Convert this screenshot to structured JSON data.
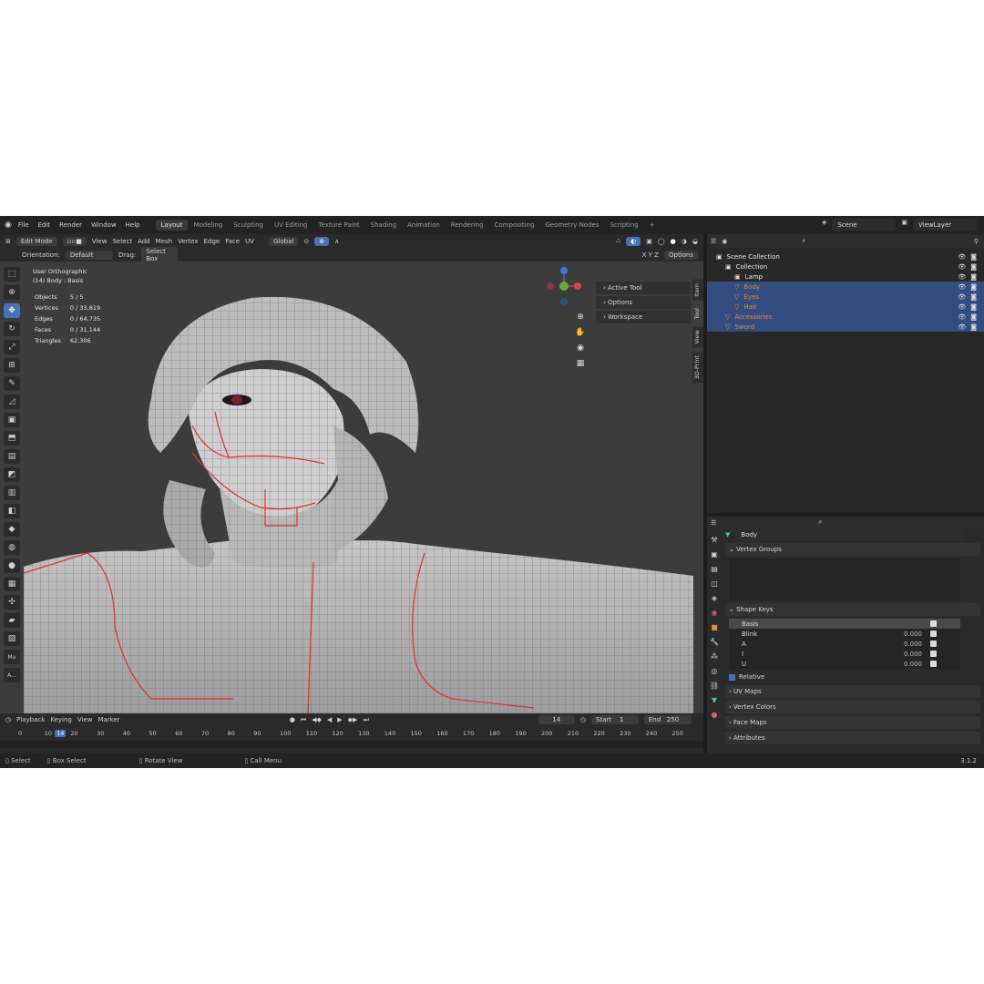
{
  "menu": [
    "File",
    "Edit",
    "Render",
    "Window",
    "Help"
  ],
  "workspaces": [
    "Layout",
    "Modeling",
    "Sculpting",
    "UV Editing",
    "Texture Paint",
    "Shading",
    "Animation",
    "Rendering",
    "Compositing",
    "Geometry Nodes",
    "Scripting",
    "+"
  ],
  "scene": "Scene",
  "view_layer": "ViewLayer",
  "viewport": {
    "mode": "Edit Mode",
    "header_menu": [
      "View",
      "Select",
      "Add",
      "Mesh",
      "Vertex",
      "Edge",
      "Face",
      "UV"
    ],
    "transform": "Global",
    "orientation_label": "Orientation:",
    "orientation_value": "Default",
    "drag_label": "Drag:",
    "drag_value": "Select Box",
    "options": "Options",
    "xyz": "X Y Z",
    "view_name": "User Orthographic",
    "object_name": "(14) Body : Basis",
    "stats": [
      {
        "label": "Objects",
        "value": "5 / 5"
      },
      {
        "label": "Vertices",
        "value": "0 / 33,819"
      },
      {
        "label": "Edges",
        "value": "0 / 64,735"
      },
      {
        "label": "Faces",
        "value": "0 / 31,144"
      },
      {
        "label": "Triangles",
        "value": "62,306"
      }
    ],
    "npanel_items": [
      "Active Tool",
      "Options",
      "Workspace"
    ],
    "side_tabs": [
      "Item",
      "Tool",
      "View",
      "3D-Print"
    ],
    "mini_labels": [
      "Mu",
      "A..."
    ]
  },
  "timeline": {
    "menu": [
      "Playback",
      "Keying",
      "View",
      "Marker"
    ],
    "current_frame": "14",
    "start_label": "Start",
    "start": "1",
    "end_label": "End",
    "end": "250",
    "ticks": [
      "0",
      "10",
      "14",
      "20",
      "30",
      "40",
      "50",
      "60",
      "70",
      "80",
      "90",
      "100",
      "110",
      "120",
      "130",
      "140",
      "150",
      "160",
      "170",
      "180",
      "190",
      "200",
      "210",
      "220",
      "230",
      "240",
      "250"
    ]
  },
  "statusbar": {
    "select": "Select",
    "box_select": "Box Select",
    "rotate": "Rotate View",
    "call_menu": "Call Menu",
    "version": "3.1.2"
  },
  "outliner": {
    "items": [
      {
        "name": "Scene Collection",
        "indent": 0,
        "sel": false,
        "white": true
      },
      {
        "name": "Collection",
        "indent": 1,
        "sel": false,
        "white": true
      },
      {
        "name": "Lamp",
        "indent": 2,
        "sel": false,
        "white": true
      },
      {
        "name": "Body",
        "indent": 2,
        "sel": true,
        "white": false
      },
      {
        "name": "Eyes",
        "indent": 2,
        "sel": true,
        "white": false
      },
      {
        "name": "Hair",
        "indent": 2,
        "sel": true,
        "white": false
      },
      {
        "name": "Accessories",
        "indent": 1,
        "sel": true,
        "white": false
      },
      {
        "name": "Sword",
        "indent": 1,
        "sel": true,
        "white": false
      }
    ]
  },
  "properties": {
    "object": "Body",
    "panels": [
      "Vertex Groups",
      "Shape Keys"
    ],
    "shape_keys": [
      {
        "name": "Basis",
        "value": ""
      },
      {
        "name": "Blink",
        "value": "0.000"
      },
      {
        "name": "A",
        "value": "0.000"
      },
      {
        "name": "I",
        "value": "0.000"
      },
      {
        "name": "U",
        "value": "0.000"
      }
    ],
    "relative": "Relative",
    "more_panels": [
      "UV Maps",
      "Vertex Colors",
      "Face Maps",
      "Attributes"
    ]
  },
  "colors": {
    "accent": "#4772b3",
    "seam": "#e0332b",
    "object_orange": "#e08a3c"
  }
}
